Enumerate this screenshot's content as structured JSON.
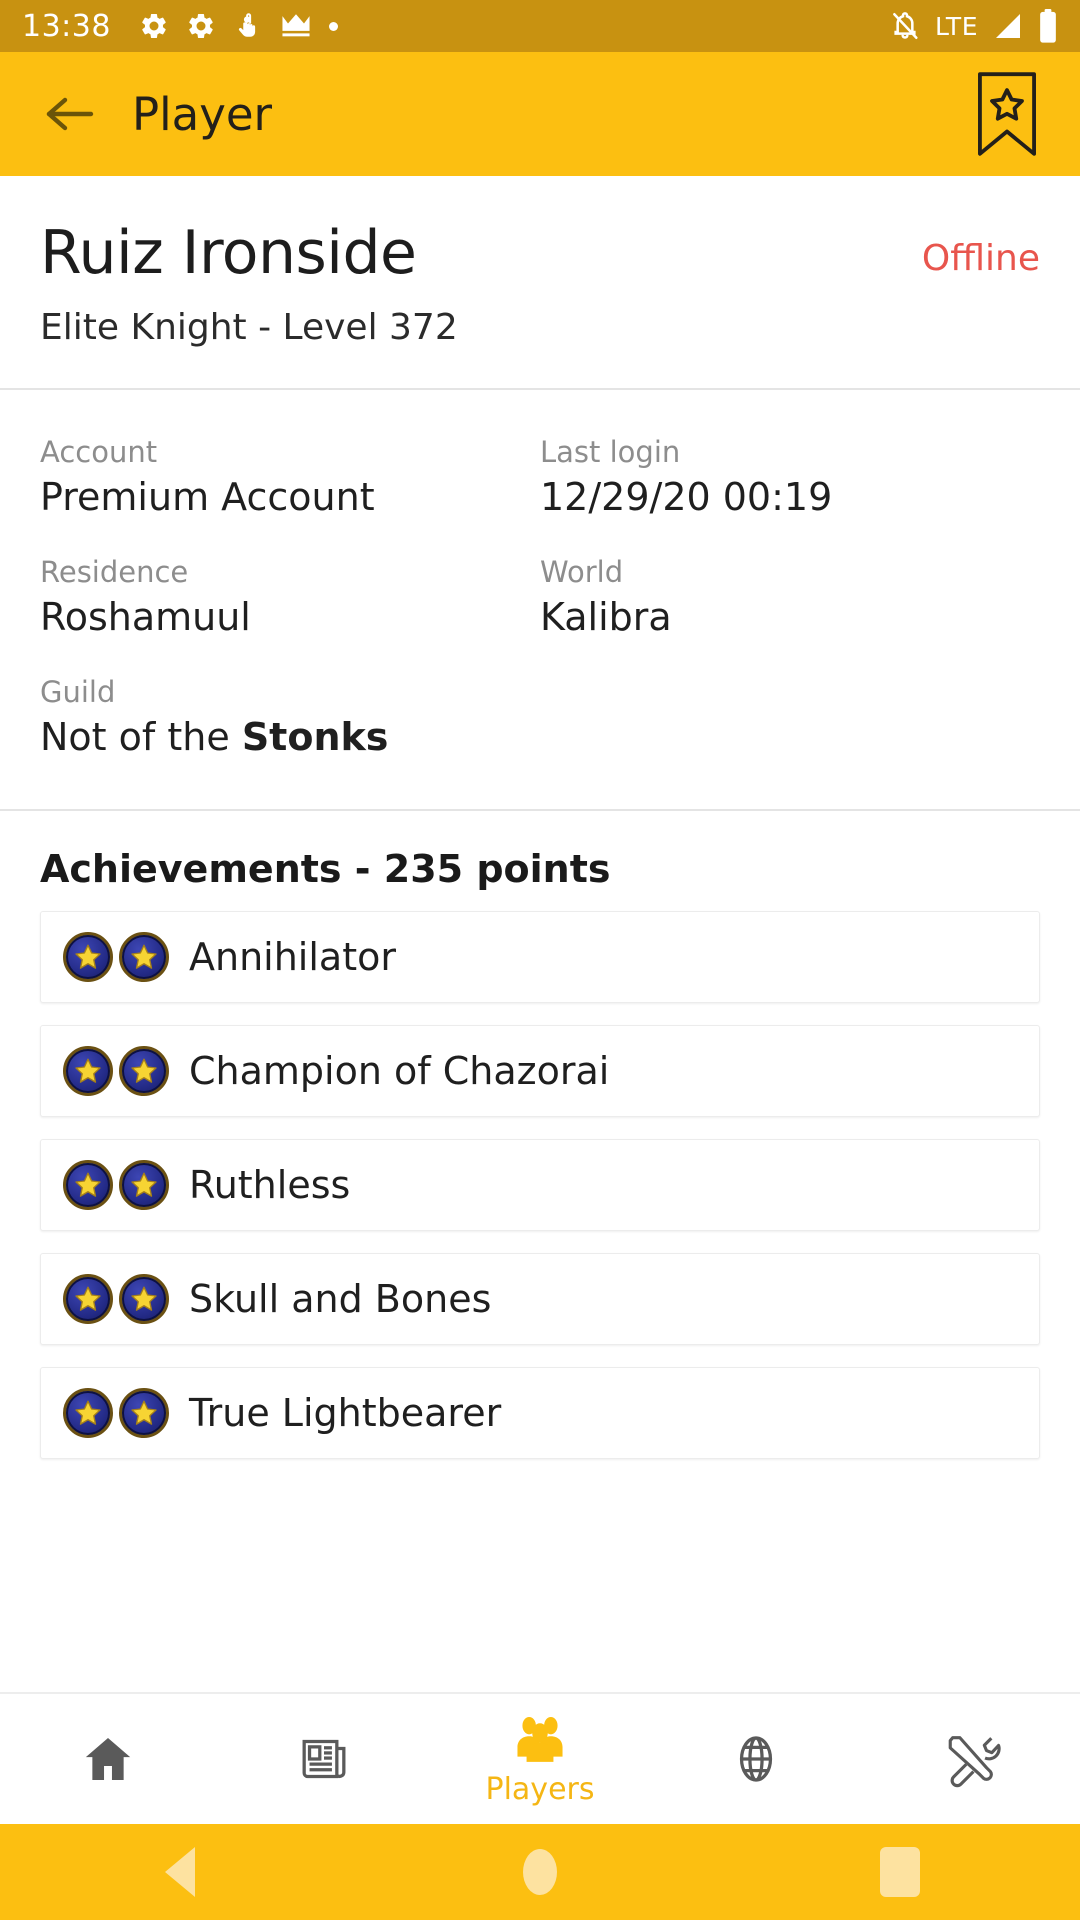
{
  "statusbar": {
    "time": "13:38",
    "left_icons": [
      "gear-icon",
      "gear-icon",
      "hand-touch-icon",
      "crown-icon",
      "dot-icon"
    ],
    "network_label": "LTE",
    "right_icons": [
      "bell-off-icon",
      "signal-icon",
      "battery-icon"
    ],
    "background": "#c89211"
  },
  "appbar": {
    "title": "Player",
    "back_icon": "arrow-left-icon",
    "bookmark_icon": "bookmark-star-icon",
    "background": "#fcbf11"
  },
  "player": {
    "name": "Ruiz Ironside",
    "status": "Offline",
    "status_color": "#e8554d",
    "subtitle": "Elite Knight - Level 372"
  },
  "details": [
    {
      "label": "Account",
      "value": "Premium Account"
    },
    {
      "label": "Last login",
      "value": "12/29/20 00:19"
    },
    {
      "label": "Residence",
      "value": "Roshamuul"
    },
    {
      "label": "World",
      "value": "Kalibra"
    },
    {
      "label": "Guild",
      "value_prefix": "Not of the ",
      "value_bold": "Stonks"
    }
  ],
  "achievements": {
    "heading": "Achievements - 235 points",
    "points": 235,
    "items": [
      {
        "name": "Annihilator",
        "stars": 2
      },
      {
        "name": "Champion of Chazorai",
        "stars": 2
      },
      {
        "name": "Ruthless",
        "stars": 2
      },
      {
        "name": "Skull and Bones",
        "stars": 2
      },
      {
        "name": "True Lightbearer",
        "stars": 2
      }
    ]
  },
  "bottomnav": {
    "active_color": "#f5b614",
    "inactive_color": "#5a5a5a",
    "items": [
      {
        "icon": "home-icon",
        "label": "",
        "active": false
      },
      {
        "icon": "news-icon",
        "label": "",
        "active": false
      },
      {
        "icon": "players-icon",
        "label": "Players",
        "active": true
      },
      {
        "icon": "globe-icon",
        "label": "",
        "active": false
      },
      {
        "icon": "tools-icon",
        "label": "",
        "active": false
      }
    ]
  },
  "androidnav": {
    "background": "#fcbf11",
    "buttons": [
      "back-button",
      "home-button",
      "recents-button"
    ]
  }
}
